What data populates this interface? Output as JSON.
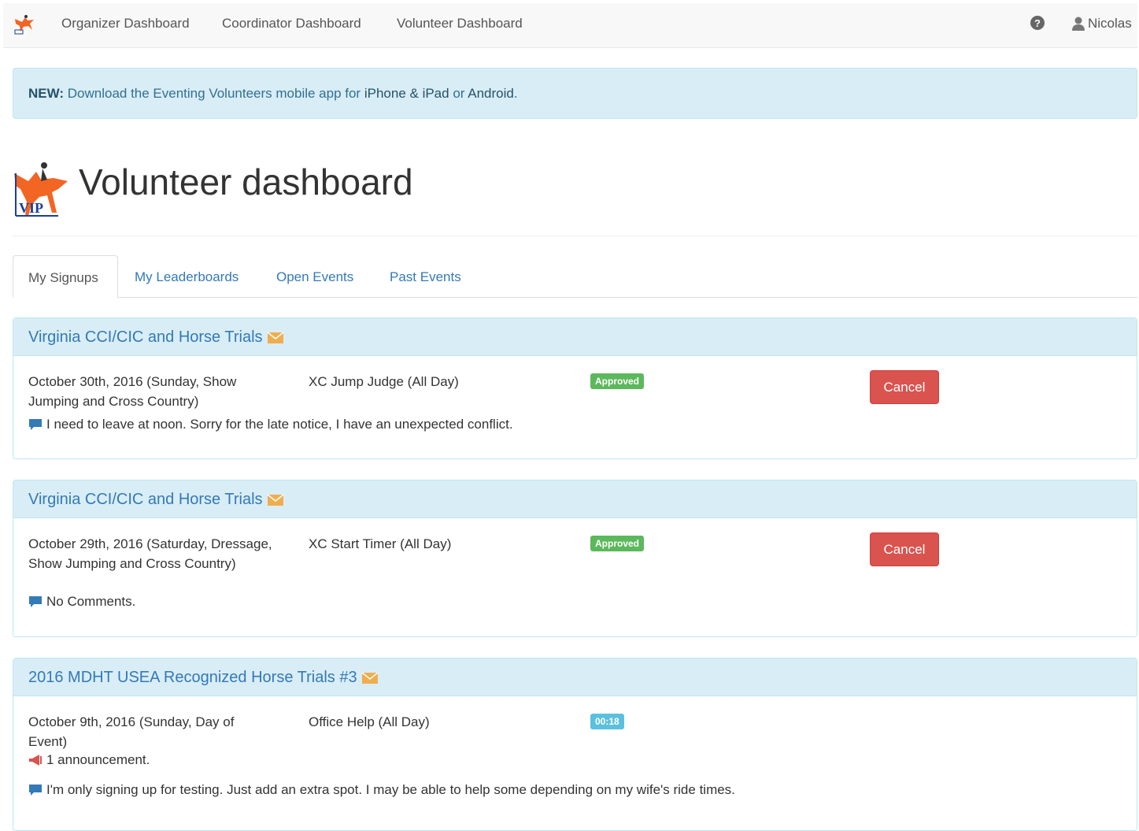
{
  "navbar": {
    "links": [
      "Organizer Dashboard",
      "Coordinator Dashboard",
      "Volunteer Dashboard"
    ],
    "user": "Nicolas"
  },
  "alert": {
    "prefix": "NEW:",
    "text": "Download the Eventing Volunteers mobile app for",
    "iphone_link": "iPhone & iPad",
    "or": "or",
    "android_link": "Android",
    "period": "."
  },
  "header": {
    "logo_text": "VIP",
    "title": "Volunteer dashboard"
  },
  "tabs": [
    "My Signups",
    "My Leaderboards",
    "Open Events",
    "Past Events"
  ],
  "signups": [
    {
      "event": "Virginia CCI/CIC and Horse Trials",
      "date": "October 30th, 2016 (Sunday, Show Jumping and Cross Country)",
      "role": "XC Jump Judge (All Day)",
      "status": "Approved",
      "cancel_label": "Cancel",
      "comment": "I need to leave at noon. Sorry for the late notice, I have an unexpected conflict."
    },
    {
      "event": "Virginia CCI/CIC and Horse Trials",
      "date": "October 29th, 2016 (Saturday, Dressage, Show Jumping and Cross Country)",
      "role": "XC Start Timer (All Day)",
      "status": "Approved",
      "cancel_label": "Cancel",
      "comment": "No Comments."
    },
    {
      "event": "2016 MDHT USEA Recognized Horse Trials #3",
      "date": "October 9th, 2016 (Sunday, Day of Event)",
      "role": "Office Help (All Day)",
      "status": "00:18",
      "announcement": "1 announcement.",
      "comment": "I'm only signing up for testing. Just add an extra spot. I may be able to help some depending on my wife's ride times."
    }
  ],
  "colors": {
    "link": "#337ab7",
    "panel_heading": "#d9edf7",
    "approved": "#5cb85c",
    "timer_badge": "#5bc0de",
    "cancel": "#d9534f",
    "logo_orange": "#f26522"
  },
  "icons": [
    "vip-logo-icon",
    "help-icon",
    "user-icon",
    "envelope-icon",
    "comment-icon",
    "bullhorn-icon"
  ]
}
